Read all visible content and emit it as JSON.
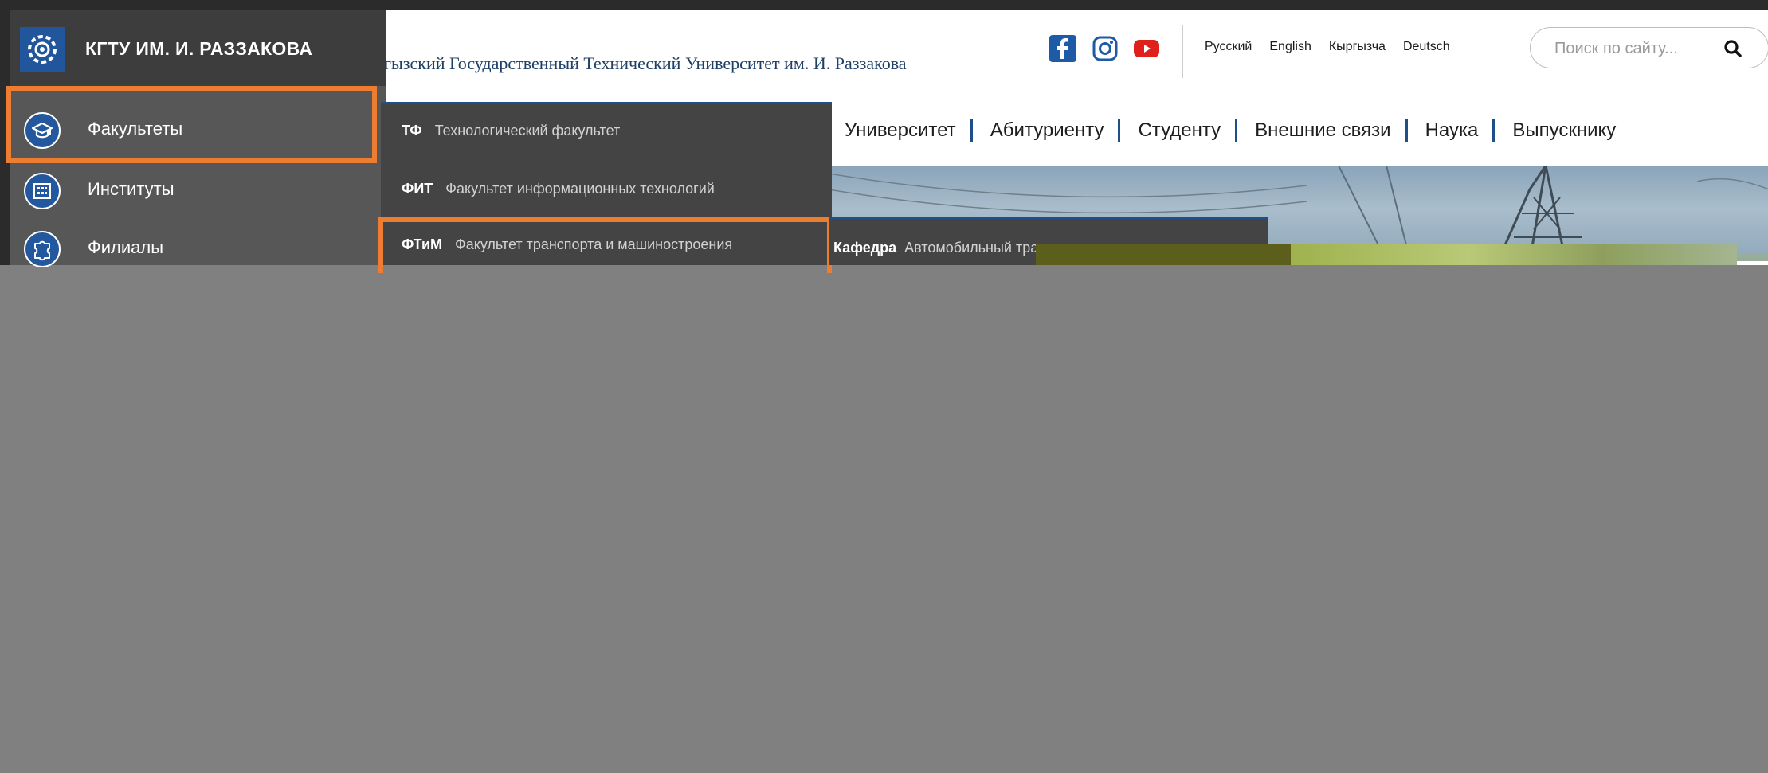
{
  "site": {
    "title": "гызский Государственный Технический Университет им. И. Раззакова",
    "languages": [
      "Русский",
      "English",
      "Кыргызча",
      "Deutsch"
    ],
    "search": {
      "placeholder": "Поиск по сайту...",
      "icon": "search-icon"
    },
    "main_nav": [
      "Университет",
      "Абитуриенту",
      "Студенту",
      "Внешние связи",
      "Наука",
      "Выпускнику"
    ],
    "social": [
      "facebook-icon",
      "instagram-icon",
      "youtube-icon"
    ]
  },
  "sidebar": {
    "brand": "КГТУ ИМ. И. РАЗЗАКОВА",
    "items": [
      {
        "label": "Факультеты",
        "icon": "graduation-cap-icon",
        "highlighted": true
      },
      {
        "label": "Институты",
        "icon": "building-icon",
        "highlighted": false
      },
      {
        "label": "Филиалы",
        "icon": "puzzle-icon",
        "highlighted": false
      }
    ]
  },
  "faculties_menu": {
    "items": [
      {
        "abbr": "ТФ",
        "name": "Технологический факультет",
        "highlighted": false
      },
      {
        "abbr": "ФИТ",
        "name": "Факультет информационных технологий",
        "highlighted": false
      },
      {
        "abbr": "ФТиМ",
        "name": "Факультет транспорта и машиностроения",
        "highlighted": true
      }
    ]
  },
  "departments_menu": {
    "prefix": "Кафедра",
    "first_item": "Автомобильный транспорт"
  },
  "colors": {
    "accent_highlight": "#ed7d31",
    "sidebar_bg": "#575757",
    "menu_bg": "#444444",
    "brand_blue": "#21569c",
    "nav_separator": "#1f4e8a",
    "overlay": "#808080"
  }
}
